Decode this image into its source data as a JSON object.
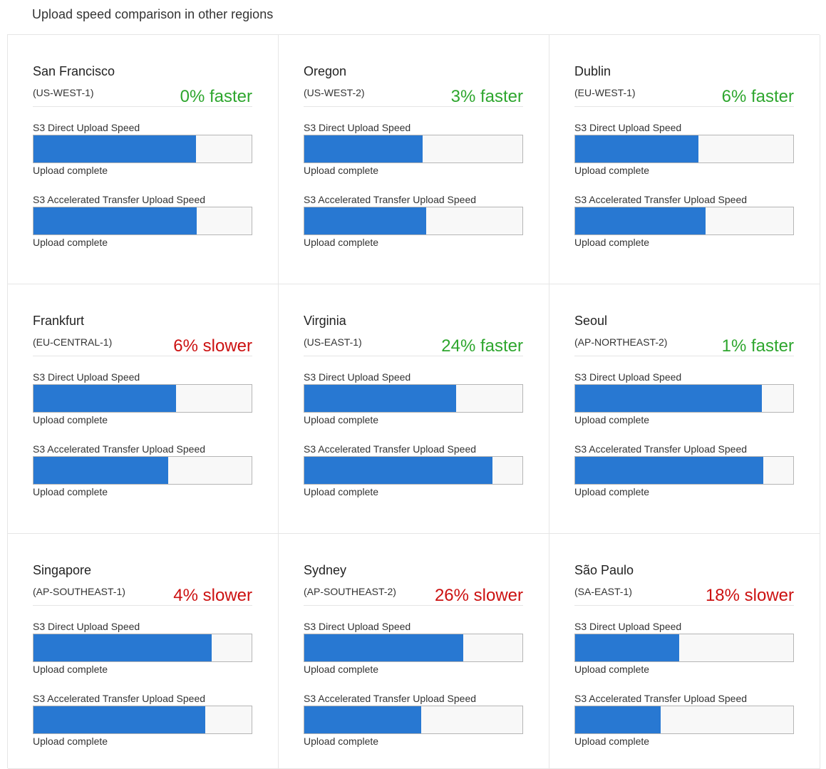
{
  "page": {
    "title": "Upload speed comparison in other regions"
  },
  "colors": {
    "faster": "#2ea62e",
    "slower": "#cc1111",
    "bar_fill": "#2878d2"
  },
  "labels": {
    "direct": "S3 Direct Upload Speed",
    "accelerated": "S3 Accelerated Transfer Upload Speed"
  },
  "regions": [
    {
      "name": "San Francisco",
      "code": "(US-WEST-1)",
      "delta": "0% faster",
      "trend": "faster",
      "direct": {
        "progress": 0.745,
        "status": "Upload complete"
      },
      "accelerated": {
        "progress": 0.748,
        "status": "Upload complete"
      }
    },
    {
      "name": "Oregon",
      "code": "(US-WEST-2)",
      "delta": "3% faster",
      "trend": "faster",
      "direct": {
        "progress": 0.542,
        "status": "Upload complete"
      },
      "accelerated": {
        "progress": 0.558,
        "status": "Upload complete"
      }
    },
    {
      "name": "Dublin",
      "code": "(EU-WEST-1)",
      "delta": "6% faster",
      "trend": "faster",
      "direct": {
        "progress": 0.566,
        "status": "Upload complete"
      },
      "accelerated": {
        "progress": 0.597,
        "status": "Upload complete"
      }
    },
    {
      "name": "Frankfurt",
      "code": "(EU-CENTRAL-1)",
      "delta": "6% slower",
      "trend": "slower",
      "direct": {
        "progress": 0.653,
        "status": "Upload complete"
      },
      "accelerated": {
        "progress": 0.617,
        "status": "Upload complete"
      }
    },
    {
      "name": "Virginia",
      "code": "(US-EAST-1)",
      "delta": "24% faster",
      "trend": "faster",
      "direct": {
        "progress": 0.695,
        "status": "Upload complete"
      },
      "accelerated": {
        "progress": 0.864,
        "status": "Upload complete"
      }
    },
    {
      "name": "Seoul",
      "code": "(AP-NORTHEAST-2)",
      "delta": "1% faster",
      "trend": "faster",
      "direct": {
        "progress": 0.857,
        "status": "Upload complete"
      },
      "accelerated": {
        "progress": 0.864,
        "status": "Upload complete"
      }
    },
    {
      "name": "Singapore",
      "code": "(AP-SOUTHEAST-1)",
      "delta": "4% slower",
      "trend": "slower",
      "direct": {
        "progress": 0.818,
        "status": "Upload complete"
      },
      "accelerated": {
        "progress": 0.786,
        "status": "Upload complete"
      }
    },
    {
      "name": "Sydney",
      "code": "(AP-SOUTHEAST-2)",
      "delta": "26% slower",
      "trend": "slower",
      "direct": {
        "progress": 0.729,
        "status": "Upload complete"
      },
      "accelerated": {
        "progress": 0.536,
        "status": "Upload complete"
      }
    },
    {
      "name": "São Paulo",
      "code": "(SA-EAST-1)",
      "delta": "18% slower",
      "trend": "slower",
      "direct": {
        "progress": 0.477,
        "status": "Upload complete"
      },
      "accelerated": {
        "progress": 0.393,
        "status": "Upload complete"
      }
    }
  ]
}
